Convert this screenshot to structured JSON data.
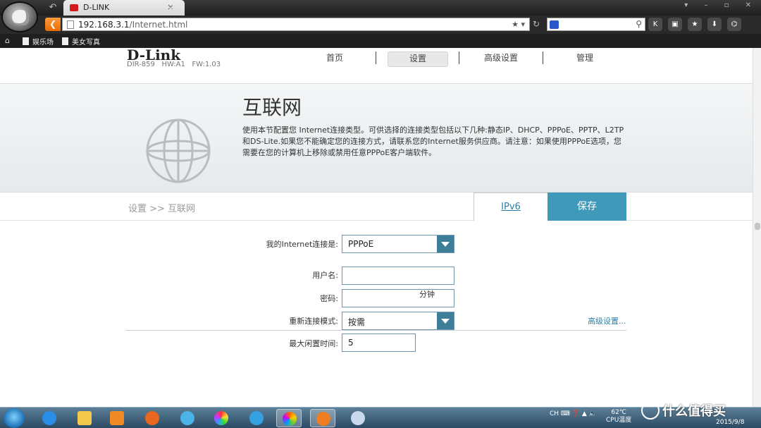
{
  "browser": {
    "tab_title": "D-LINK",
    "tab_close": "×",
    "new_tab": "+",
    "url_host": "192.168.3.1",
    "url_path": "/Internet.html",
    "bookmarks": [
      "娱乐场",
      "美女写真"
    ],
    "toolbar_icons": [
      "K",
      "lock-icon",
      "star-icon",
      "download-icon",
      "gamepad-icon"
    ]
  },
  "router": {
    "brand": "D-Link",
    "model": "DIR-859",
    "hw": "HW:A1",
    "fw": "FW:1.03",
    "nav": [
      {
        "label": "首页",
        "active": false
      },
      {
        "label": "设置",
        "active": true
      },
      {
        "label": "高级设置",
        "active": false
      },
      {
        "label": "管理",
        "active": false
      }
    ]
  },
  "banner": {
    "title": "互联网",
    "description": "使用本节配置您 Internet连接类型。可供选择的连接类型包括以下几种:静态IP、DHCP、PPPoE、PPTP、L2TP和DS-Lite.如果您不能确定您的连接方式，请联系您的Internet服务供应商。请注意：如果使用PPPoE选项，您需要在您的计算机上移除或禁用任意PPPoE客户端软件。"
  },
  "breadcrumb": "设置 >> 互联网",
  "tabs": {
    "ipv6": "IPv6",
    "save": "保存"
  },
  "form": {
    "connection_label": "我的Internet连接是:",
    "connection_value": "PPPoE",
    "username_label": "用户名:",
    "username_value": "",
    "password_label": "密码:",
    "password_value": "",
    "reconnect_label": "重新连接模式:",
    "reconnect_value": "按需",
    "idle_label": "最大闲置时间:",
    "idle_value": "5",
    "idle_unit": "分钟",
    "advanced_link": "高级设置..."
  },
  "taskbar": {
    "lang": "CH",
    "temp": "62℃",
    "temp_label": "CPU温度",
    "date": "2015/9/8"
  },
  "watermark": "什么值得买",
  "colors": {
    "accent": "#3e9ab8",
    "select_arrow": "#3e7e99",
    "link": "#2e7fa8"
  }
}
